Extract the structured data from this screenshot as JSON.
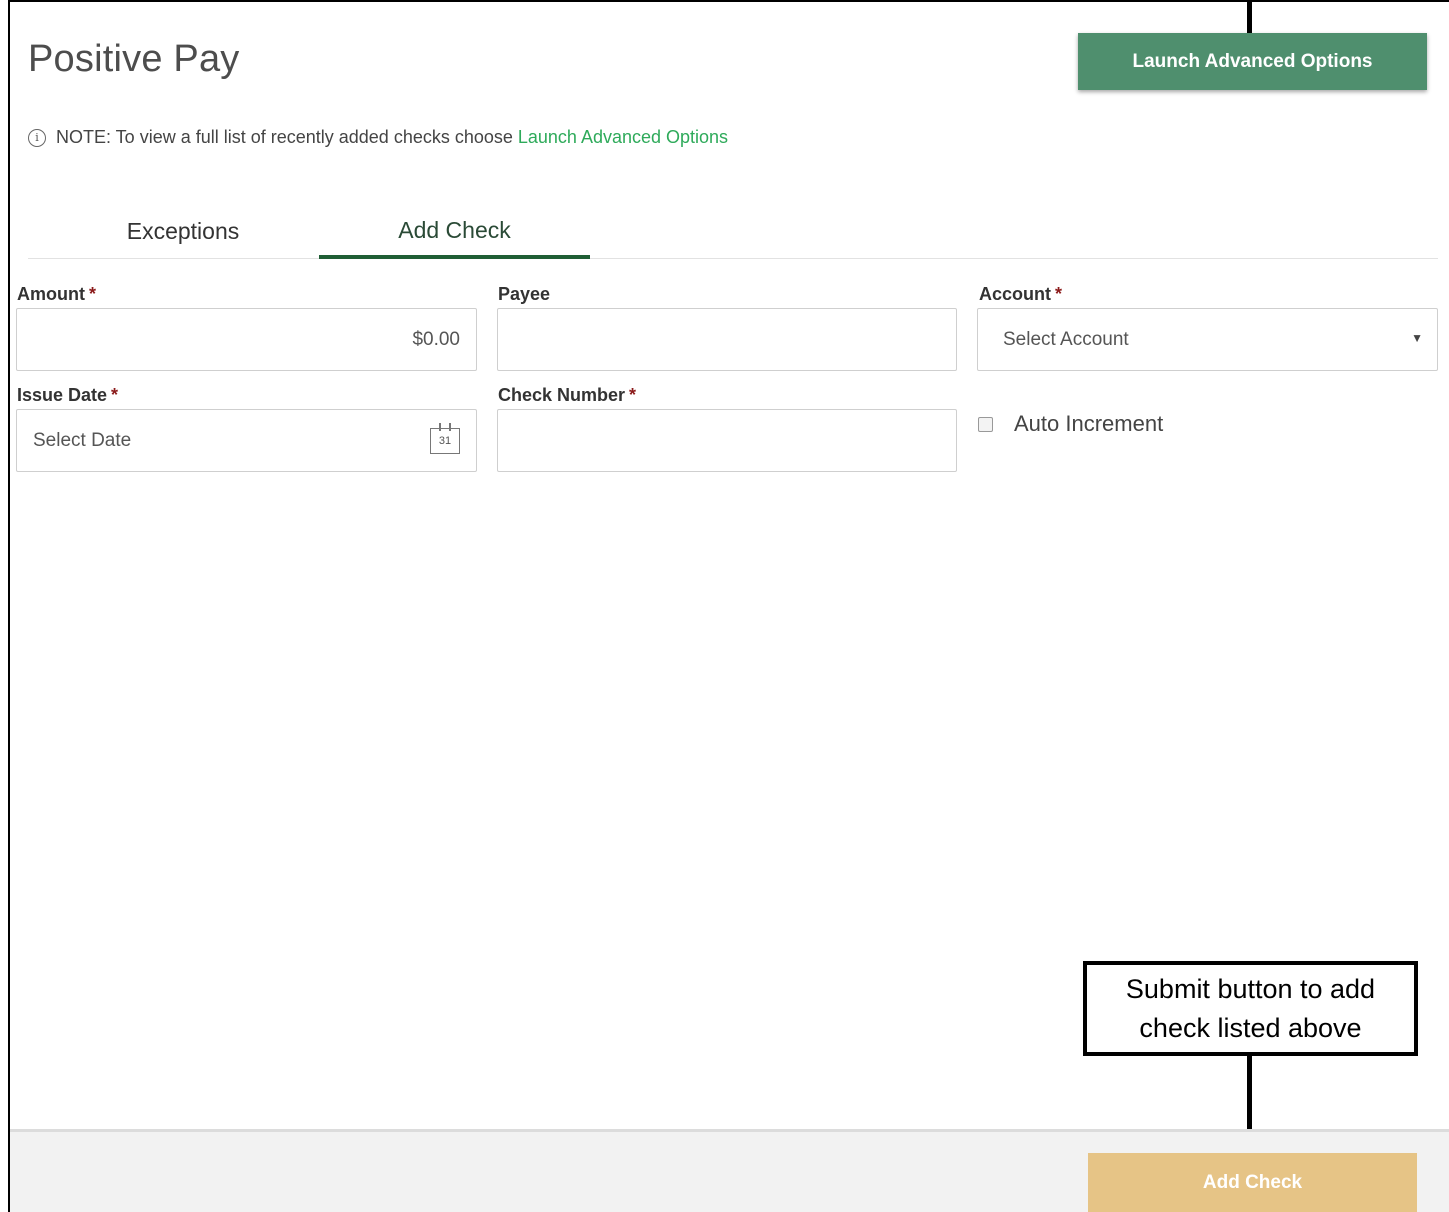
{
  "header": {
    "title": "Positive Pay",
    "advanced_button": "Launch Advanced Options"
  },
  "note": {
    "icon": "info-icon",
    "text": "NOTE: To view a full list of recently added checks choose",
    "link": "Launch Advanced Options"
  },
  "tabs": [
    {
      "label": "Exceptions",
      "active": false
    },
    {
      "label": "Add Check",
      "active": true
    }
  ],
  "form": {
    "amount": {
      "label": "Amount",
      "required": "*",
      "value": "$0.00"
    },
    "payee": {
      "label": "Payee",
      "value": ""
    },
    "account": {
      "label": "Account",
      "required": "*",
      "selected": "Select Account"
    },
    "issue_date": {
      "label": "Issue Date",
      "required": "*",
      "placeholder": "Select Date",
      "calendar_day": "31"
    },
    "check_number": {
      "label": "Check Number",
      "required": "*",
      "value": ""
    },
    "auto_increment": {
      "label": "Auto Increment",
      "checked": false
    }
  },
  "footer": {
    "submit_button": "Add Check"
  },
  "callout": {
    "line1": "Submit button to add",
    "line2": "check listed above"
  },
  "colors": {
    "primary_button": "#4f8f6e",
    "link": "#2eaa5a",
    "active_tab": "#1f5e35",
    "submit_disabled": "#e6c486",
    "required": "#8b1a1a"
  }
}
